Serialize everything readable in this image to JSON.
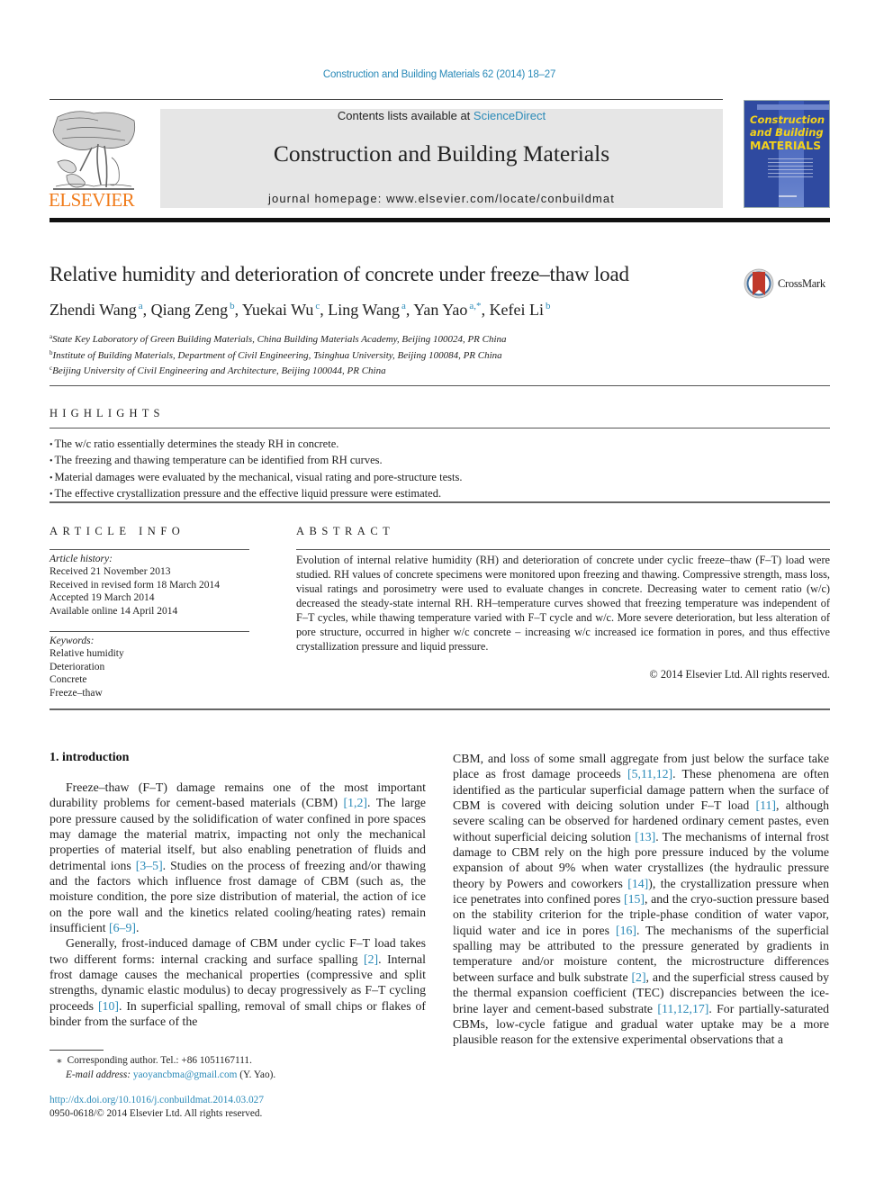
{
  "journal_ref": "Construction and Building Materials 62 (2014) 18–27",
  "header": {
    "contents_prefix": "Contents lists available at ",
    "contents_link": "ScienceDirect",
    "journal_title": "Construction and Building Materials",
    "homepage": "journal homepage: www.elsevier.com/locate/conbuildmat",
    "publisher": "ELSEVIER",
    "cover": {
      "line1": "Construction",
      "line2": "and Building",
      "line3": "MATERIALS"
    },
    "colors": {
      "link": "#2a8ab8",
      "elsevier_orange": "#f07b1a",
      "cover_blue": "#2f4aa0",
      "cover_yellow": "#f3d21c",
      "banner_gray": "#e6e6e6"
    }
  },
  "article": {
    "title": "Relative humidity and deterioration of concrete under freeze–thaw load",
    "crossmark_label": "CrossMark",
    "authors": [
      {
        "name": "Zhendi Wang",
        "aff": "a"
      },
      {
        "name": "Qiang Zeng",
        "aff": "b"
      },
      {
        "name": "Yuekai Wu",
        "aff": "c"
      },
      {
        "name": "Ling Wang",
        "aff": "a"
      },
      {
        "name": "Yan Yao",
        "aff": "a,*"
      },
      {
        "name": "Kefei Li",
        "aff": "b"
      }
    ],
    "affiliations": [
      {
        "mark": "a",
        "text": "State Key Laboratory of Green Building Materials, China Building Materials Academy, Beijing 100024, PR China"
      },
      {
        "mark": "b",
        "text": "Institute of Building Materials, Department of Civil Engineering, Tsinghua University, Beijing 100084, PR China"
      },
      {
        "mark": "c",
        "text": "Beijing University of Civil Engineering and Architecture, Beijing 100044, PR China"
      }
    ]
  },
  "highlights": {
    "heading": "HIGHLIGHTS",
    "items": [
      "The w/c ratio essentially determines the steady RH in concrete.",
      "The freezing and thawing temperature can be identified from RH curves.",
      "Material damages were evaluated by the mechanical, visual rating and pore-structure tests.",
      "The effective crystallization pressure and the effective liquid pressure were estimated."
    ]
  },
  "article_info": {
    "heading": "ARTICLE INFO",
    "history_label": "Article history:",
    "history": [
      "Received 21 November 2013",
      "Received in revised form 18 March 2014",
      "Accepted 19 March 2014",
      "Available online 14 April 2014"
    ],
    "keywords_label": "Keywords:",
    "keywords": [
      "Relative humidity",
      "Deterioration",
      "Concrete",
      "Freeze–thaw"
    ]
  },
  "abstract": {
    "heading": "ABSTRACT",
    "text": "Evolution of internal relative humidity (RH) and deterioration of concrete under cyclic freeze–thaw (F–T) load were studied. RH values of concrete specimens were monitored upon freezing and thawing. Compressive strength, mass loss, visual ratings and porosimetry were used to evaluate changes in concrete. Decreasing water to cement ratio (w/c) decreased the steady-state internal RH. RH–temperature curves showed that freezing temperature was independent of F–T cycles, while thawing temperature varied with F–T cycle and w/c. More severe deterioration, but less alteration of pore structure, occurred in higher w/c concrete – increasing w/c increased ice formation in pores, and thus effective crystallization pressure and liquid pressure.",
    "copyright": "© 2014 Elsevier Ltd. All rights reserved."
  },
  "body": {
    "section_heading": "1. introduction",
    "left_paragraphs": [
      [
        {
          "t": "Freeze–thaw (F–T) damage remains one of the most important durability problems for cement-based materials (CBM) "
        },
        {
          "ref": "[1,2]"
        },
        {
          "t": ". The large pore pressure caused by the solidification of water confined in pore spaces may damage the material matrix, impacting not only the mechanical properties of material itself, but also enabling penetration of fluids and detrimental ions "
        },
        {
          "ref": "[3–5]"
        },
        {
          "t": ". Studies on the process of freezing and/or thawing and the factors which influence frost damage of CBM (such as, the moisture condition, the pore size distribution of material, the action of ice on the pore wall and the kinetics related cooling/heating rates) remain insufficient "
        },
        {
          "ref": "[6–9]"
        },
        {
          "t": "."
        }
      ],
      [
        {
          "t": "Generally, frost-induced damage of CBM under cyclic F–T load takes two different forms: internal cracking and surface spalling "
        },
        {
          "ref": "[2]"
        },
        {
          "t": ". Internal frost damage causes the mechanical properties (compressive and split strengths, dynamic elastic modulus) to decay progressively as F–T cycling proceeds "
        },
        {
          "ref": "[10]"
        },
        {
          "t": ". In superficial spalling, removal of small chips or flakes of binder from the surface of the"
        }
      ]
    ],
    "right_paragraphs": [
      [
        {
          "t": "CBM, and loss of some small aggregate from just below the surface take place as frost damage proceeds "
        },
        {
          "ref": "[5,11,12]"
        },
        {
          "t": ". These phenomena are often identified as the particular superficial damage pattern when the surface of CBM is covered with deicing solution under F–T load "
        },
        {
          "ref": "[11]"
        },
        {
          "t": ", although severe scaling can be observed for hardened ordinary cement pastes, even without superficial deicing solution "
        },
        {
          "ref": "[13]"
        },
        {
          "t": ". The mechanisms of internal frost damage to CBM rely on the high pore pressure induced by the volume expansion of about 9% when water crystallizes (the hydraulic pressure theory by Powers and coworkers "
        },
        {
          "ref": "[14]"
        },
        {
          "t": "), the crystallization pressure when ice penetrates into confined pores "
        },
        {
          "ref": "[15]"
        },
        {
          "t": ", and the cryo-suction pressure based on the stability criterion for the triple-phase condition of water vapor, liquid water and ice in pores "
        },
        {
          "ref": "[16]"
        },
        {
          "t": ". The mechanisms of the superficial spalling may be attributed to the pressure generated by gradients in temperature and/or moisture content, the microstructure differences between surface and bulk substrate "
        },
        {
          "ref": "[2]"
        },
        {
          "t": ", and the superficial stress caused by the thermal expansion coefficient (TEC) discrepancies between the ice-brine layer and cement-based substrate "
        },
        {
          "ref": "[11,12,17]"
        },
        {
          "t": ". For partially-saturated CBMs, low-cycle fatigue and gradual water uptake may be a more plausible reason for the extensive experimental observations that a"
        }
      ]
    ]
  },
  "footnote": {
    "star": "⁎",
    "corresponding": "Corresponding author. Tel.: +86 1051167111.",
    "email_label": "E-mail address:",
    "email": "yaoyancbma@gmail.com",
    "email_suffix": " (Y. Yao)."
  },
  "doi": {
    "link": "http://dx.doi.org/10.1016/j.conbuildmat.2014.03.027",
    "issn_line": "0950-0618/© 2014 Elsevier Ltd. All rights reserved."
  }
}
